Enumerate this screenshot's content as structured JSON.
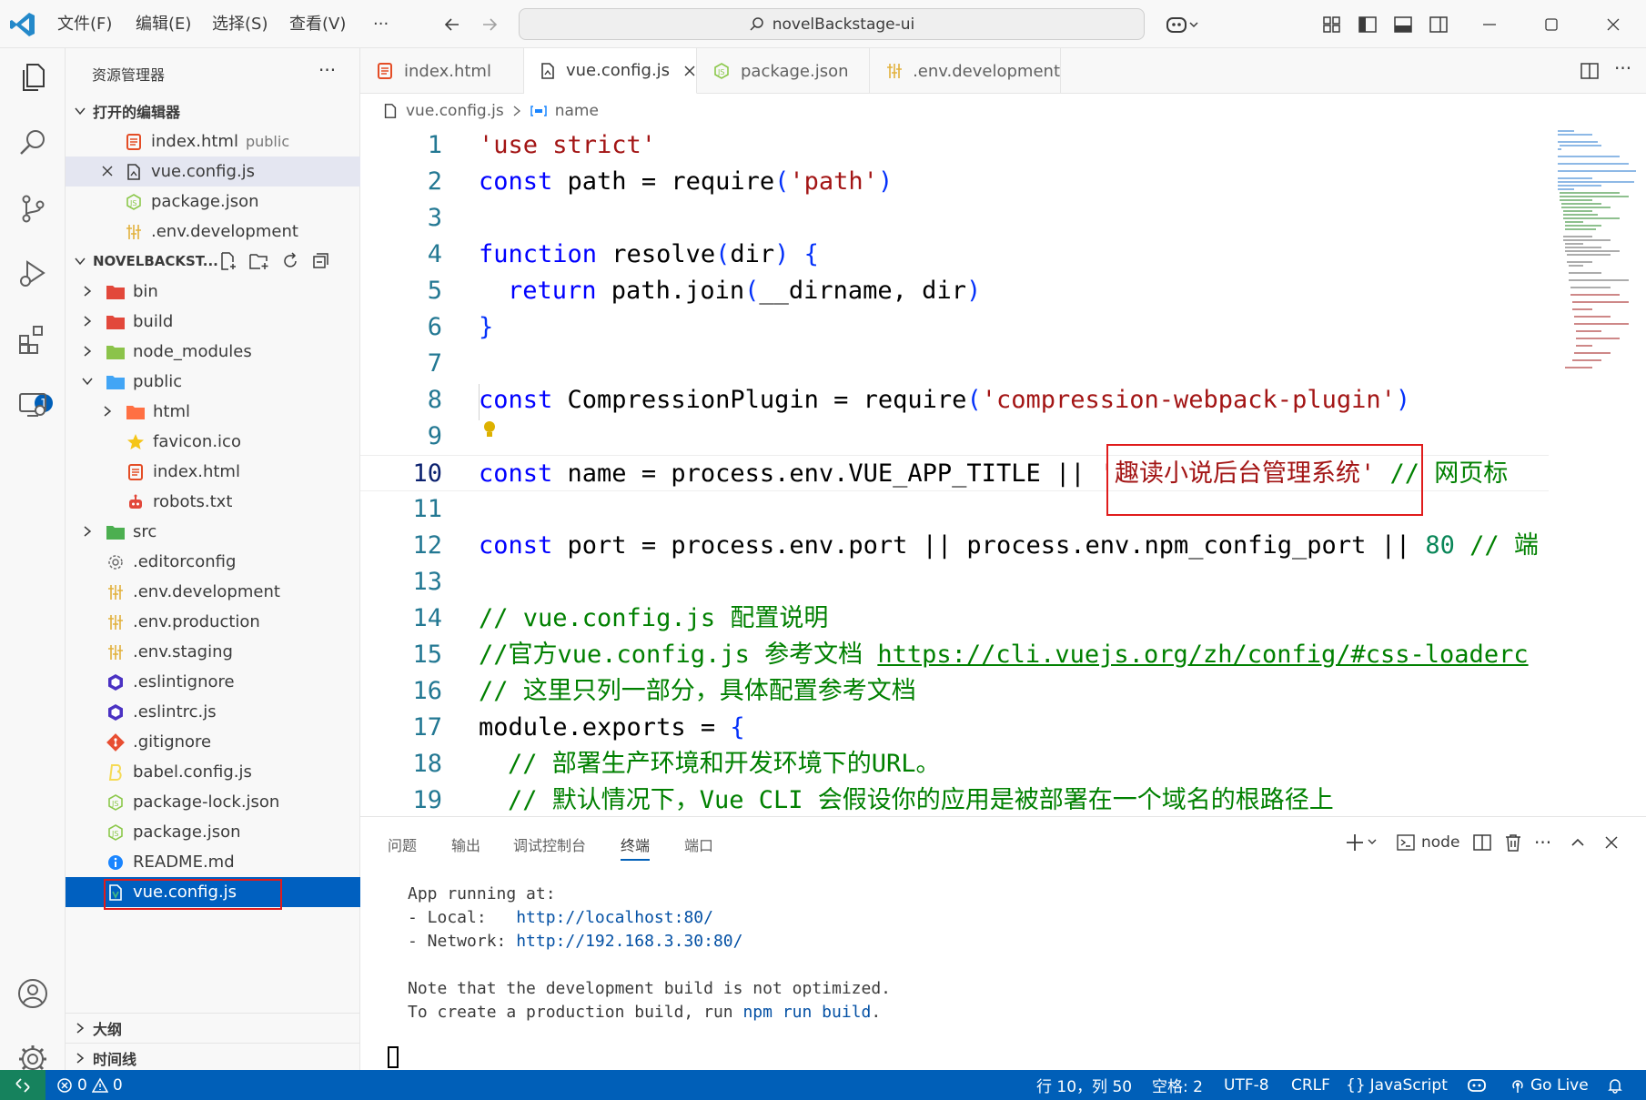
{
  "titlebar": {
    "menus": [
      "文件(F)",
      "编辑(E)",
      "选择(S)",
      "查看(V)",
      "···"
    ],
    "search_text": "novelBackstage-ui"
  },
  "activity": {
    "extensions_badge": "1"
  },
  "explorer": {
    "title": "资源管理器",
    "more": "···",
    "open_editors_header": "打开的编辑器",
    "open_editors": [
      {
        "name": "index.html",
        "desc": "public",
        "icon": "html-icon"
      },
      {
        "name": "vue.config.js",
        "icon": "js-icon"
      },
      {
        "name": "package.json",
        "icon": "json-icon"
      },
      {
        "name": ".env.development",
        "icon": "env-icon"
      }
    ],
    "project_header": "NOVELBACKST...",
    "tree": [
      {
        "name": "bin",
        "icon": "folder-icon"
      },
      {
        "name": "build",
        "icon": "folder-icon"
      },
      {
        "name": "node_modules",
        "icon": "folder-icon"
      },
      {
        "name": "public",
        "icon": "folder-icon"
      },
      {
        "name": "html",
        "icon": "folder-icon"
      },
      {
        "name": "favicon.ico",
        "icon": "star-icon"
      },
      {
        "name": "index.html",
        "icon": "html-icon"
      },
      {
        "name": "robots.txt",
        "icon": "robot-icon"
      },
      {
        "name": "src",
        "icon": "folder-icon"
      },
      {
        "name": ".editorconfig",
        "icon": "gear-icon"
      },
      {
        "name": ".env.development",
        "icon": "env-icon"
      },
      {
        "name": ".env.production",
        "icon": "env-icon"
      },
      {
        "name": ".env.staging",
        "icon": "env-icon"
      },
      {
        "name": ".eslintignore",
        "icon": "eslint-icon"
      },
      {
        "name": ".eslintrc.js",
        "icon": "eslint-icon"
      },
      {
        "name": ".gitignore",
        "icon": "git-icon"
      },
      {
        "name": "babel.config.js",
        "icon": "babel-icon"
      },
      {
        "name": "package-lock.json",
        "icon": "json-icon"
      },
      {
        "name": "package.json",
        "icon": "json-icon"
      },
      {
        "name": "README.md",
        "icon": "info-icon"
      },
      {
        "name": "vue.config.js",
        "icon": "vue-config-icon"
      }
    ],
    "outline_header": "大纲",
    "timeline_header": "时间线"
  },
  "tabs": [
    {
      "label": "index.html",
      "icon": "html-icon"
    },
    {
      "label": "vue.config.js",
      "icon": "js-icon",
      "active": true
    },
    {
      "label": "package.json",
      "icon": "json-icon"
    },
    {
      "label": ".env.development",
      "icon": "env-icon"
    }
  ],
  "breadcrumb": {
    "file": "vue.config.js",
    "symbol": "name"
  },
  "code": {
    "line_numbers": [
      "1",
      "2",
      "3",
      "4",
      "5",
      "6",
      "7",
      "8",
      "9",
      "10",
      "11",
      "12",
      "13",
      "14",
      "15",
      "16",
      "17",
      "18",
      "19"
    ],
    "tokens": {
      "l1_str": "'use strict'",
      "l2_kw": "const",
      "l2_a": " path = ",
      "l2_fn": "require",
      "l2_p1": "(",
      "l2_str": "'path'",
      "l2_p2": ")",
      "l4_kw": "function",
      "l4_a": " resolve",
      "l4_p1": "(",
      "l4_b": "dir",
      "l4_p2": ")",
      "l4_c": " ",
      "l4_br": "{",
      "l5_kw": "return",
      "l5_a": " path.join",
      "l5_p1": "(",
      "l5_b": "__dirname, dir",
      "l5_p2": ")",
      "l6_br": "}",
      "l8_kw": "const",
      "l8_a": " CompressionPlugin = require",
      "l8_p1": "(",
      "l8_str": "'compression-webpack-plugin'",
      "l8_p2": ")",
      "l10_kw": "const",
      "l10_a": " name = process.env.VUE_APP_TITLE || ",
      "l10_str": "'趣读小说后台管理系统'",
      "l10_cmt": " // 网页标",
      "l12_kw": "const",
      "l12_a": " port = process.env.port || process.env.npm_config_port || ",
      "l12_num": "80",
      "l12_cmt": " // 端",
      "l14_cmt": "// vue.config.js 配置说明",
      "l15_cmt": "//官方vue.config.js 参考文档 ",
      "l15_url": "https://cli.vuejs.org/zh/config/#css-loaderc",
      "l16_cmt": "// 这里只列一部分，具体配置参考文档",
      "l17_a": "module.exports = ",
      "l17_br": "{",
      "l18_cmt": "// 部署生产环境和开发环境下的URL。",
      "l19_cmt": "// 默认情况下，Vue CLI 会假设你的应用是被部署在一个域名的根路径上"
    }
  },
  "panel": {
    "tabs": [
      "问题",
      "输出",
      "调试控制台",
      "终端",
      "端口"
    ],
    "active_tab": "终端",
    "shell": "node",
    "terminal": {
      "line1": "App running at:",
      "local_label": "- Local:   ",
      "local_url": "http://localhost:80/",
      "network_label": "- Network: ",
      "network_url": "http://192.168.3.30:80/",
      "line4": "Note that the development build is not optimized.",
      "line5_a": "To create a production build, run ",
      "line5_cmd": "npm run build",
      "line5_b": "."
    }
  },
  "statusbar": {
    "errors": "0",
    "warnings": "0",
    "position": "行 10，列 50",
    "spaces": "空格: 2",
    "encoding": "UTF-8",
    "eol": "CRLF",
    "language": "JavaScript",
    "golive": "Go Live"
  },
  "colors": {
    "accent": "#005fb8",
    "keyword": "#0000ff",
    "string": "#a31515",
    "comment": "#008000",
    "highlight_box": "#e01c1c"
  }
}
